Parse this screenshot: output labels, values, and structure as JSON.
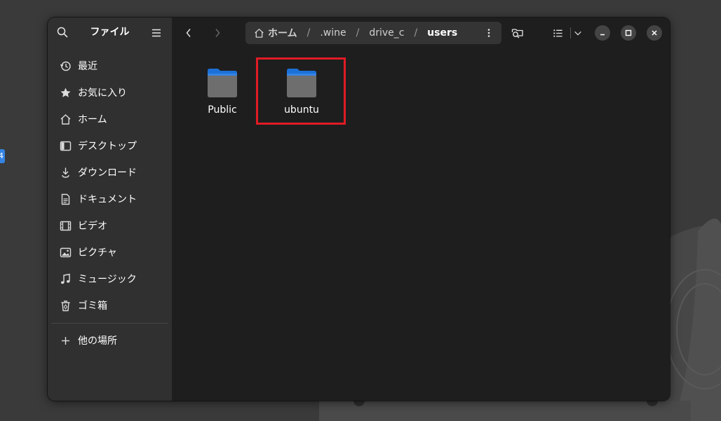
{
  "app": {
    "sidebar_title": "ファイル"
  },
  "sidebar": {
    "items": [
      {
        "label": "最近",
        "icon": "recent-icon"
      },
      {
        "label": "お気に入り",
        "icon": "star-icon"
      },
      {
        "label": "ホーム",
        "icon": "home-icon"
      },
      {
        "label": "デスクトップ",
        "icon": "desktop-icon"
      },
      {
        "label": "ダウンロード",
        "icon": "download-icon"
      },
      {
        "label": "ドキュメント",
        "icon": "document-icon"
      },
      {
        "label": "ビデオ",
        "icon": "video-icon"
      },
      {
        "label": "ピクチャ",
        "icon": "picture-icon"
      },
      {
        "label": "ミュージック",
        "icon": "music-icon"
      },
      {
        "label": "ゴミ箱",
        "icon": "trash-icon"
      }
    ],
    "other_places": {
      "label": "他の場所",
      "icon": "plus-icon"
    }
  },
  "path": {
    "home": "ホーム",
    "sep": "/",
    "segments": [
      ".wine",
      "drive_c"
    ],
    "current": "users"
  },
  "content": {
    "items": [
      {
        "label": "Public",
        "icon": "folder-icon"
      },
      {
        "label": "ubuntu",
        "icon": "folder-icon",
        "highlighted": true
      }
    ]
  },
  "dock": {
    "badge": "4"
  },
  "colors": {
    "accent": "#3584e4",
    "highlight": "#e01b24",
    "sidebar_bg": "#303030",
    "content_bg": "#1e1e1e"
  }
}
